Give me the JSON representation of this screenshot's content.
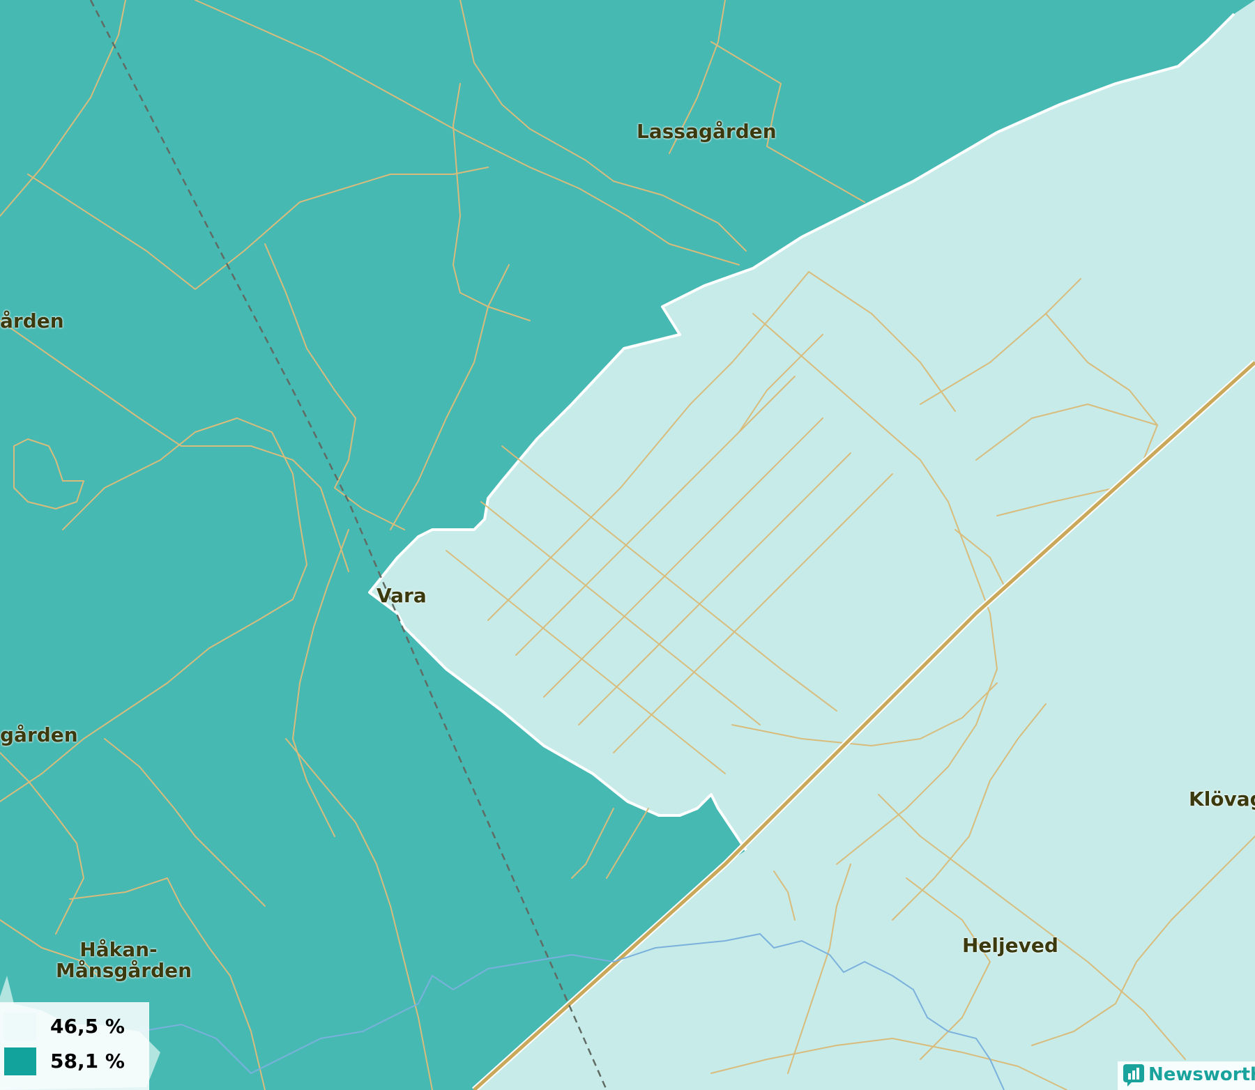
{
  "map": {
    "places": [
      {
        "id": "lassagarden",
        "label": "Lassagården"
      },
      {
        "id": "arden",
        "label": "ården"
      },
      {
        "id": "vara",
        "label": "Vara"
      },
      {
        "id": "garden",
        "label": "gården"
      },
      {
        "id": "klovaga",
        "label": "Klövaga"
      },
      {
        "id": "heljeved",
        "label": "Heljeved"
      },
      {
        "id": "hakan-1",
        "label": "Håkan-"
      },
      {
        "id": "hakan-2",
        "label": "Månsgården"
      }
    ],
    "colors": {
      "region_high": "#46b9b3",
      "region_low": "#c6ebe8",
      "roads": "#d9bc7c",
      "highway": "#c9a85a",
      "railway": "#5f6b63",
      "water": "#7ab0dc",
      "border": "#ffffff"
    }
  },
  "legend": {
    "items": [
      {
        "label": "46,5 %",
        "color": "#eefaf9"
      },
      {
        "label": "58,1 %",
        "color": "#12a49c"
      }
    ]
  },
  "brand": {
    "name": "Newsworthy",
    "icon": "bar-chart-icon",
    "color": "#1aa39d"
  }
}
